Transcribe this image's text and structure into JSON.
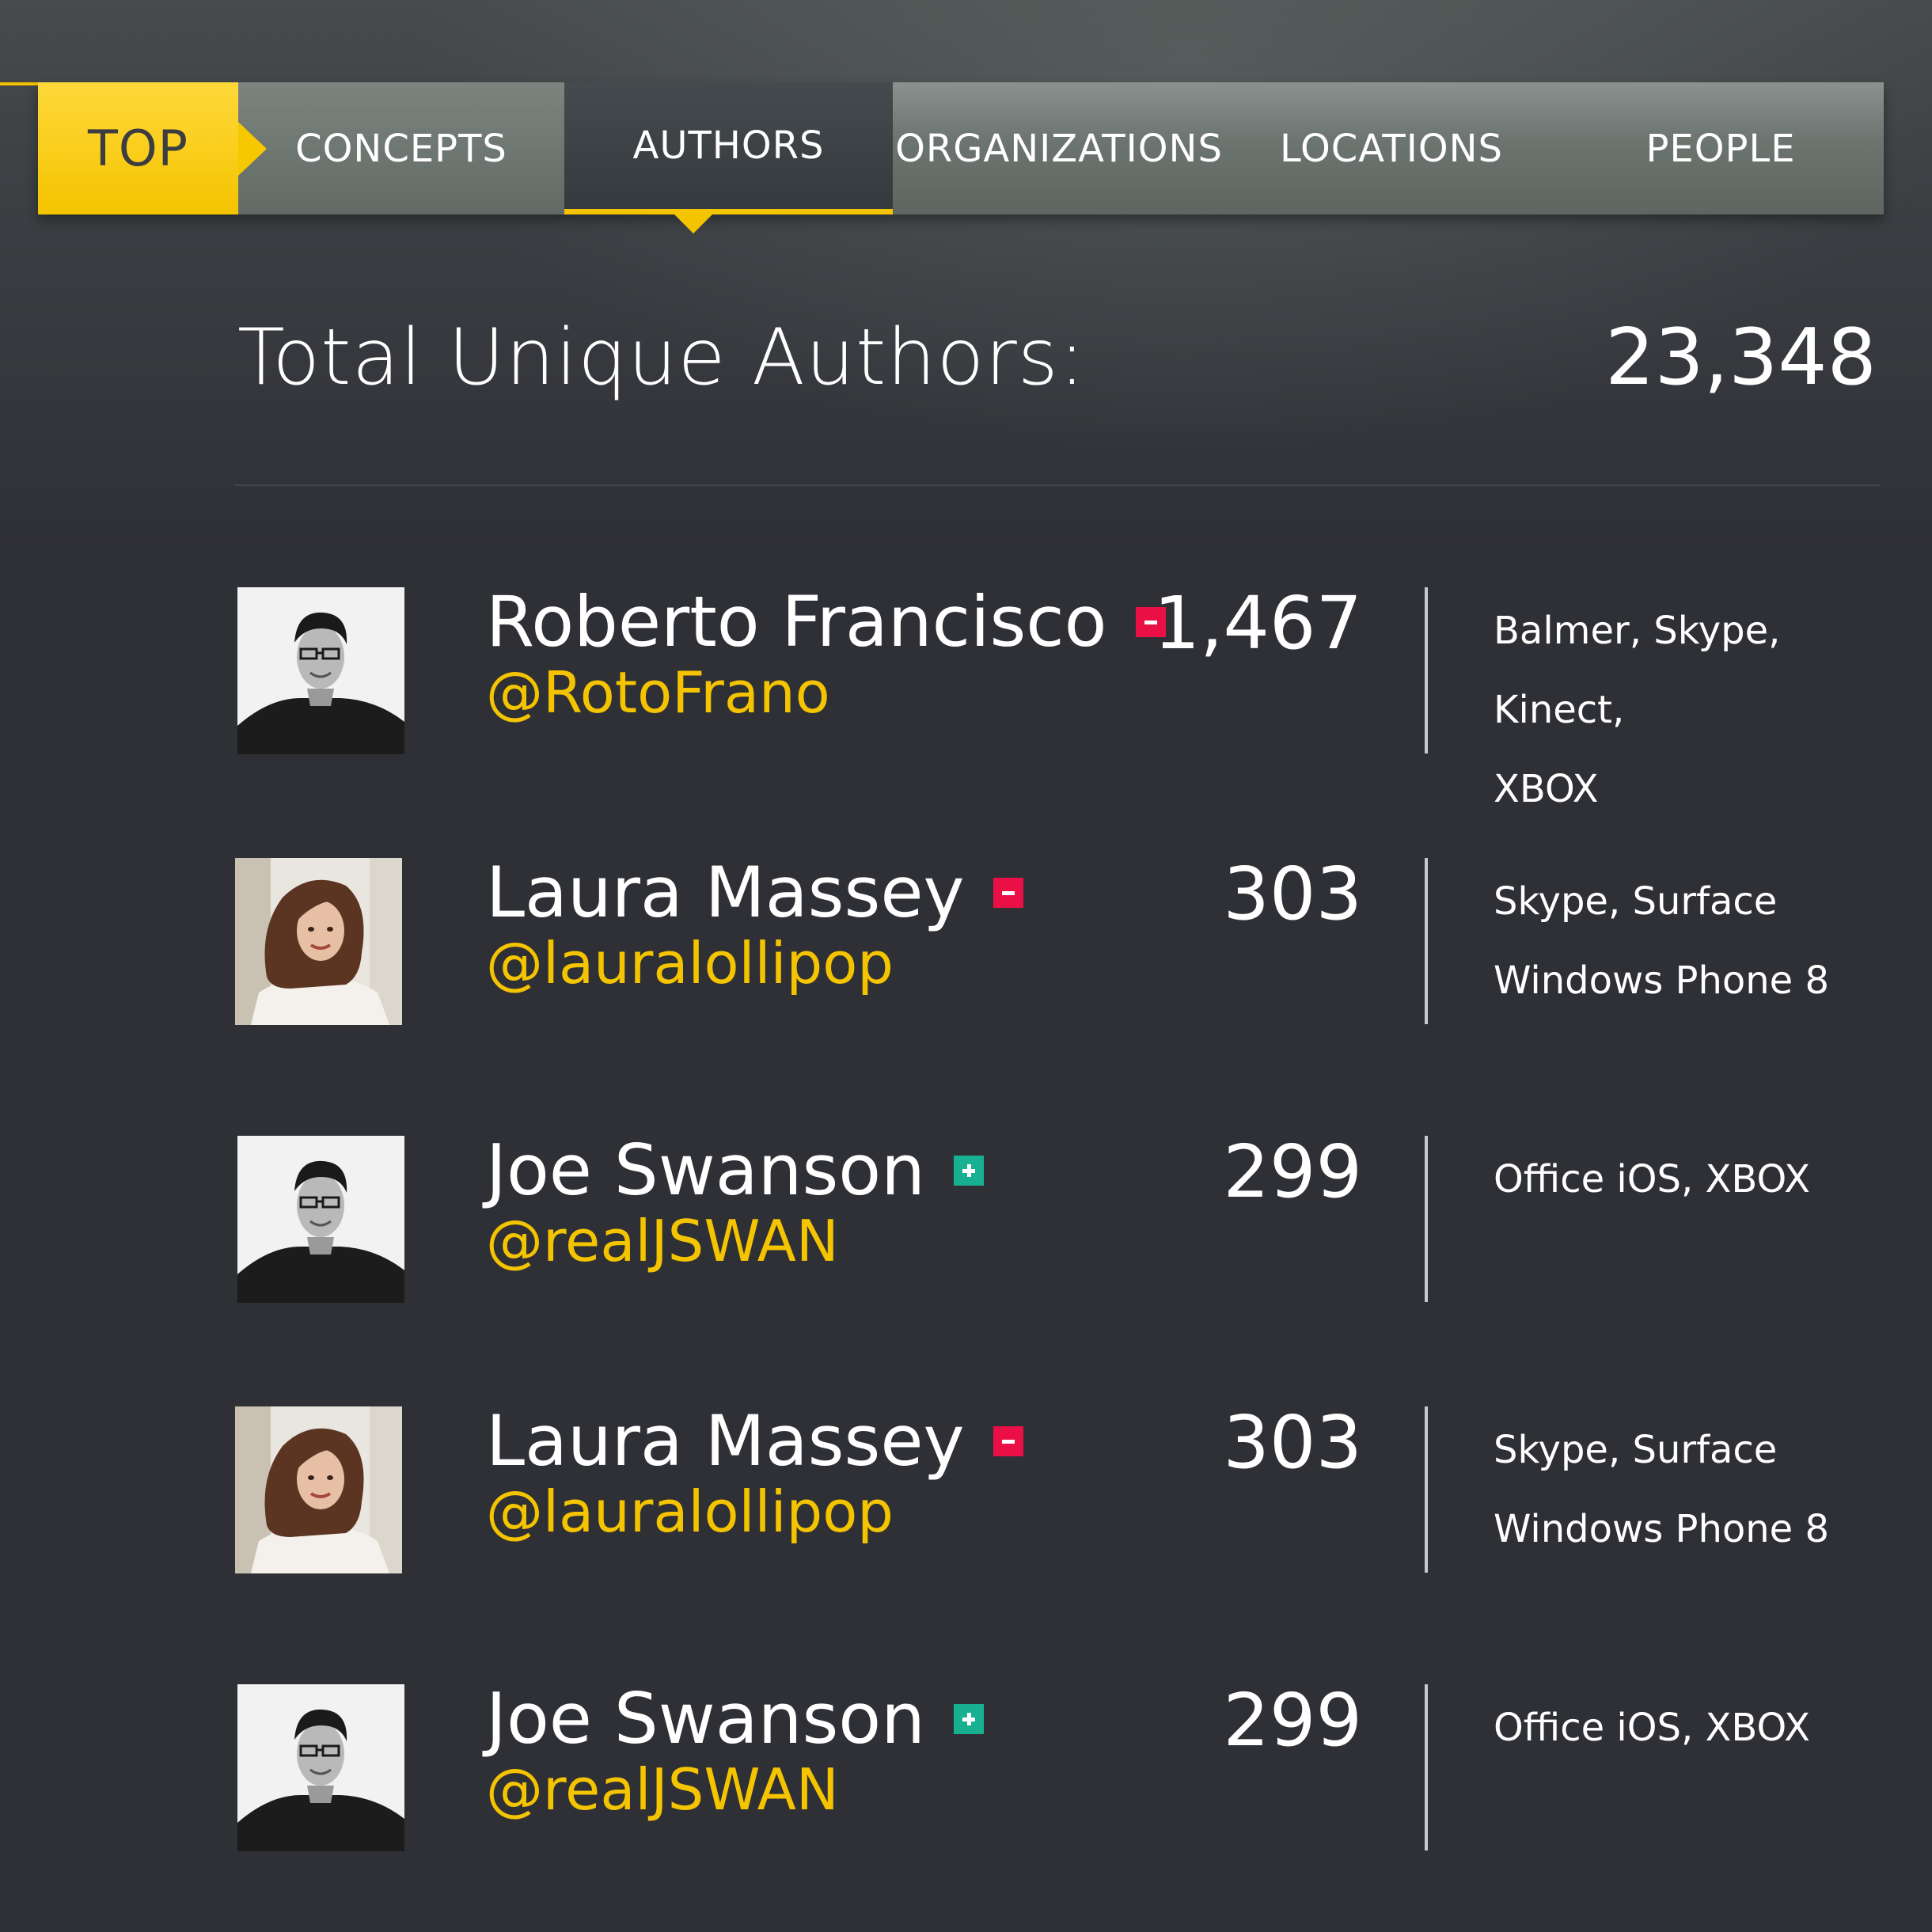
{
  "nav": {
    "tabs": [
      {
        "label": "TOP"
      },
      {
        "label": "CONCEPTS"
      },
      {
        "label": "AUTHORS"
      },
      {
        "label": "ORGANIZATIONS"
      },
      {
        "label": "LOCATIONS"
      },
      {
        "label": "PEOPLE"
      }
    ],
    "active_tab": "AUTHORS",
    "accent_color": "#f4c400"
  },
  "summary": {
    "label": "Total Unique Authors:",
    "value": "23,348"
  },
  "authors": [
    {
      "name": "Roberto Francisco",
      "handle": "@RotoFrano",
      "trend": "minus",
      "count": "1,467",
      "topics_line1": "Balmer, Skype, Kinect,",
      "topics_line2": "XBOX",
      "avatar": "man-bw"
    },
    {
      "name": "Laura Massey",
      "handle": "@lauralollipop",
      "trend": "minus",
      "count": "303",
      "topics_line1": "Skype, Surface",
      "topics_line2": "Windows Phone 8",
      "avatar": "woman-color"
    },
    {
      "name": "Joe Swanson",
      "handle": "@realJSWAN",
      "trend": "plus",
      "count": "299",
      "topics_line1": "Office iOS, XBOX",
      "topics_line2": "",
      "avatar": "man-bw"
    },
    {
      "name": "Laura Massey",
      "handle": "@lauralollipop",
      "trend": "minus",
      "count": "303",
      "topics_line1": "Skype, Surface",
      "topics_line2": "Windows Phone 8",
      "avatar": "woman-color"
    },
    {
      "name": "Joe Swanson",
      "handle": "@realJSWAN",
      "trend": "plus",
      "count": "299",
      "topics_line1": "Office iOS, XBOX",
      "topics_line2": "",
      "avatar": "man-bw"
    }
  ],
  "colors": {
    "handle": "#f4c400",
    "minus_badge": "#ea0f45",
    "plus_badge": "#17b090"
  }
}
